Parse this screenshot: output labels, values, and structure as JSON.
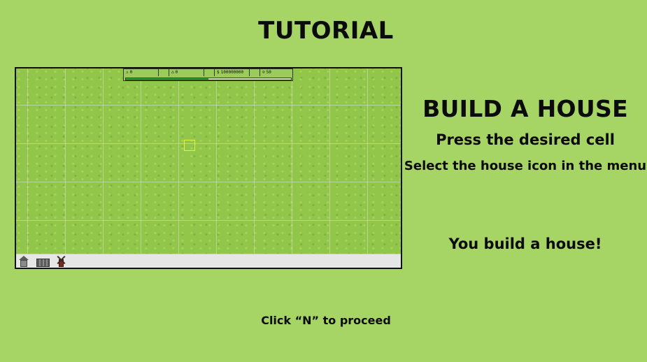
{
  "title": "TUTORIAL",
  "step": {
    "heading": "BUILD A HOUSE",
    "instruction_1": "Press the desired cell",
    "instruction_2": "Select the house icon in the menu",
    "result": "You build a house!"
  },
  "footer": {
    "hint": "Click “N” to proceed"
  },
  "preview": {
    "hud": {
      "stats": [
        {
          "icon": "person-icon",
          "glyph": "♙",
          "value": "0"
        },
        {
          "icon": "home-icon",
          "glyph": "⌂",
          "value": "0"
        },
        {
          "icon": "money-icon",
          "glyph": "$",
          "value": "100000000"
        },
        {
          "icon": "happiness-icon",
          "glyph": "☺",
          "value": "50"
        }
      ],
      "progress": 0.5
    },
    "menu": {
      "items": [
        "house-icon",
        "wall-icon",
        "windmill-icon"
      ]
    }
  },
  "colors": {
    "background": "#a6d465",
    "grass": "#92c64b",
    "progress": "#2ea43c",
    "menu_bar": "#e6e6e6",
    "cell_highlight": "#e8f23a"
  }
}
